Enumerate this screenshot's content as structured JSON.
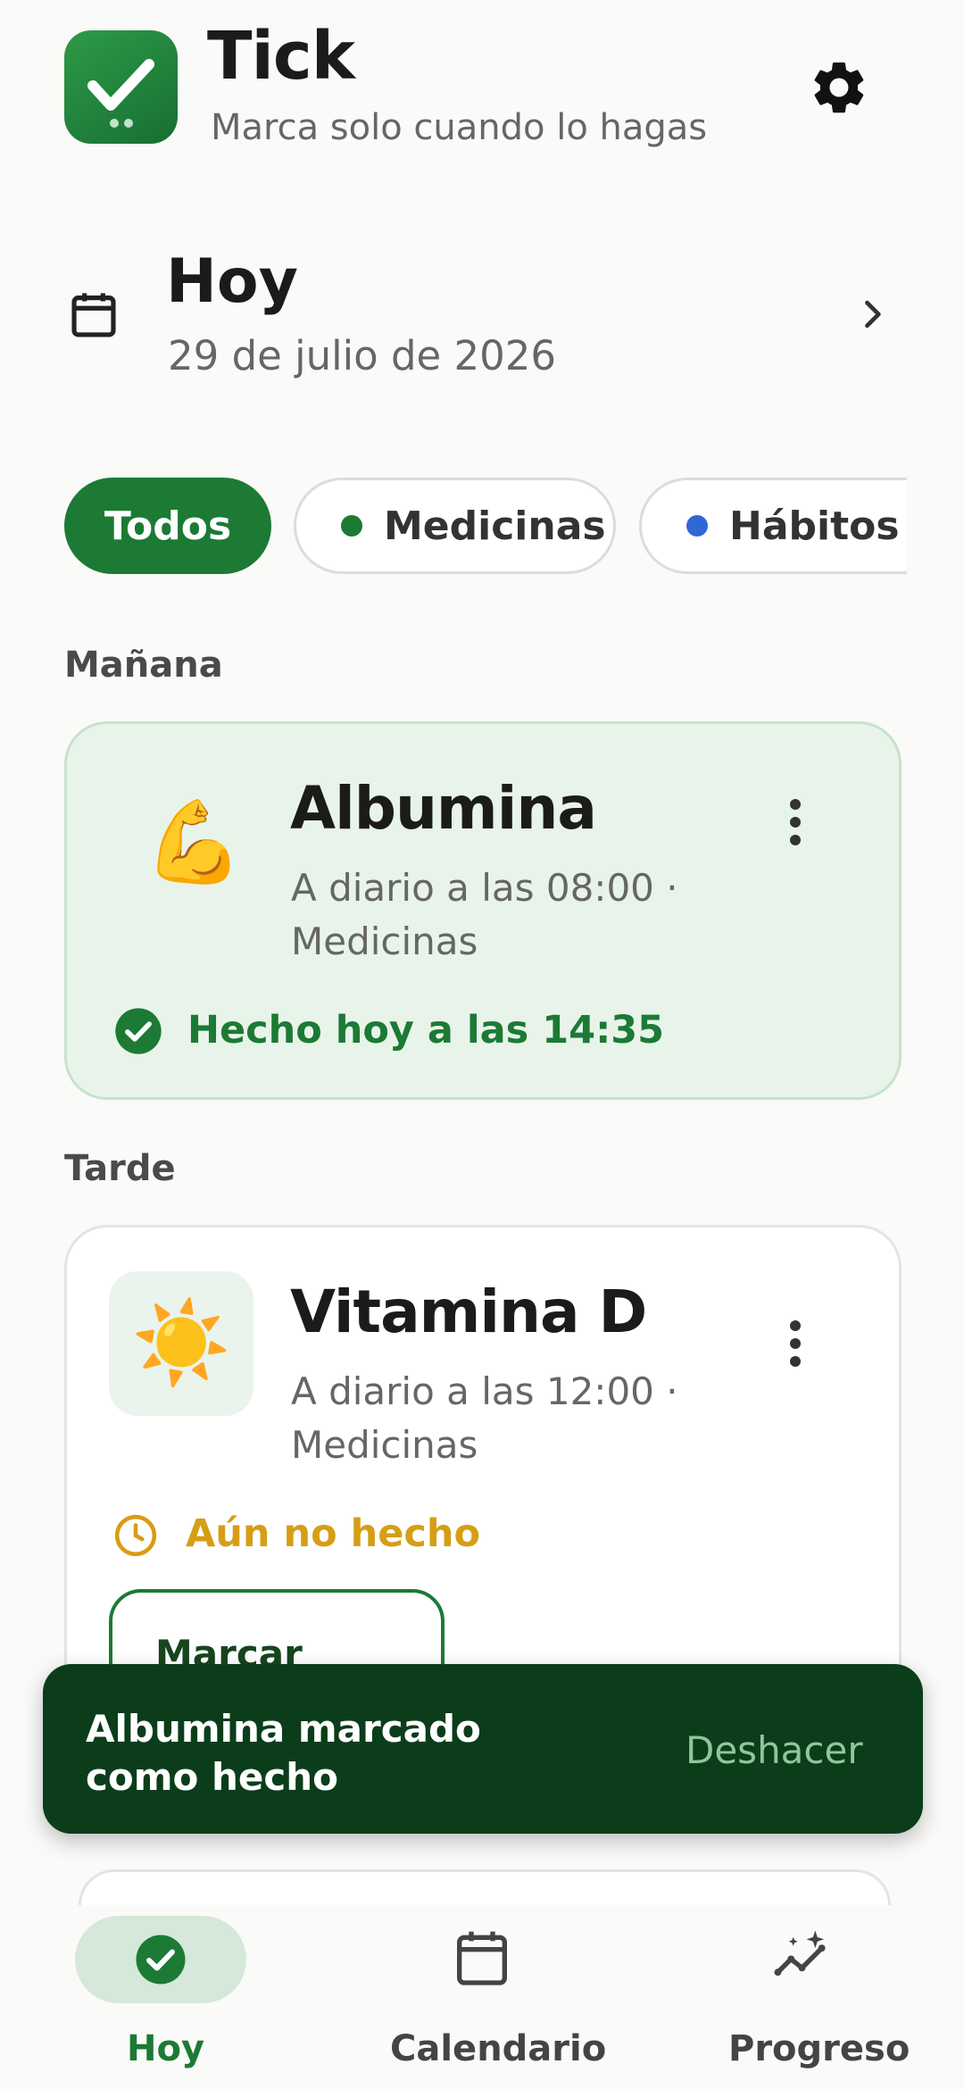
{
  "header": {
    "app_name": "Tick",
    "tagline": "Marca solo cuando lo hagas",
    "settings_icon": "gear-icon"
  },
  "date_nav": {
    "title": "Hoy",
    "date": "29 de julio de 2026"
  },
  "filters": [
    {
      "label": "Todos",
      "selected": true
    },
    {
      "label": "Medicinas",
      "color": "#1c7a35"
    },
    {
      "label": "Hábitos",
      "color": "#2f67d6"
    }
  ],
  "sections": [
    {
      "label": "Mañana",
      "items": [
        {
          "icon": "💪",
          "title": "Albumina",
          "schedule": "A diario a las 08:00 · Medicinas",
          "status": "Hecho hoy a las 14:35"
        }
      ]
    },
    {
      "label": "Tarde",
      "items": [
        {
          "icon": "☀️",
          "title": "Vitamina D",
          "schedule": "A diario a las 12:00 · Medicinas",
          "status": "Aún no hecho",
          "action": "Marcar hecho"
        }
      ]
    }
  ],
  "snackbar": {
    "message": "Albumina marcado como hecho",
    "action": "Deshacer"
  },
  "bottom_nav": [
    {
      "label": "Hoy",
      "icon": "check-circle-icon",
      "active": true
    },
    {
      "label": "Calendario",
      "icon": "calendar-icon"
    },
    {
      "label": "Progreso",
      "icon": "sparkle-chart-icon"
    }
  ],
  "colors": {
    "primary": "#1c7a35",
    "done_card_bg": "#e8f4ea",
    "pending": "#d69e14",
    "snackbar_bg": "#0b3d1a"
  }
}
